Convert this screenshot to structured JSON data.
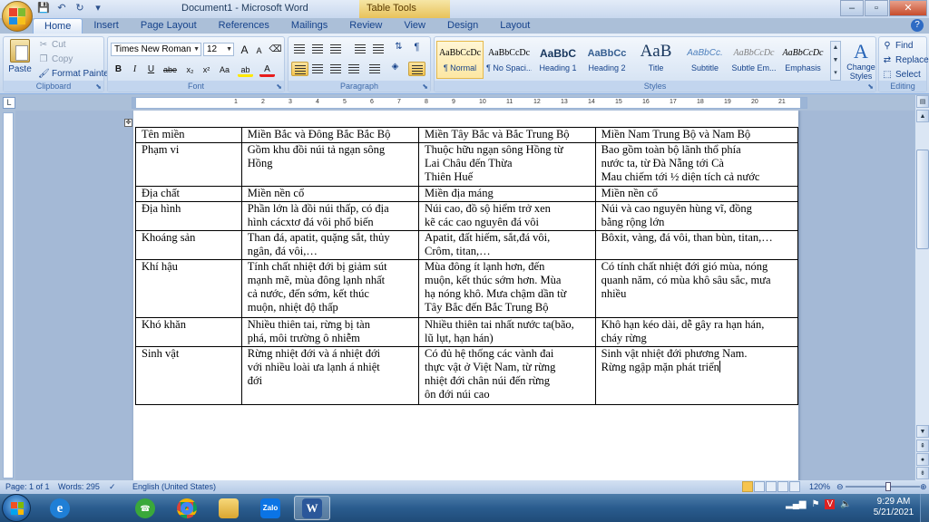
{
  "window": {
    "title": "Document1 - Microsoft Word",
    "context_tab": "Table Tools",
    "controls": [
      "–",
      "▫",
      "✕"
    ]
  },
  "qat": {
    "save": "💾",
    "undo": "↶",
    "redo": "↻",
    "more": "▾"
  },
  "tabs": [
    "Home",
    "Insert",
    "Page Layout",
    "References",
    "Mailings",
    "Review",
    "View",
    "Design",
    "Layout"
  ],
  "ribbon": {
    "clipboard": {
      "label": "Clipboard",
      "paste": "Paste",
      "cut": "Cut",
      "copy": "Copy",
      "format_painter": "Format Painter"
    },
    "font": {
      "label": "Font",
      "name": "Times New Roman",
      "size": "12",
      "grow": "A",
      "shrink": "A",
      "bold": "B",
      "italic": "I",
      "underline": "U",
      "strike": "abe",
      "sub": "x₂",
      "sup": "x²",
      "case": "Aa",
      "highlight": "ab",
      "color": "A"
    },
    "paragraph": {
      "label": "Paragraph"
    },
    "styles": {
      "label": "Styles",
      "items": [
        {
          "sample": "AaBbCcDc",
          "name": "¶ Normal"
        },
        {
          "sample": "AaBbCcDc",
          "name": "¶ No Spaci..."
        },
        {
          "sample": "AaBbC",
          "name": "Heading 1"
        },
        {
          "sample": "AaBbCc",
          "name": "Heading 2"
        },
        {
          "sample": "AaB",
          "name": "Title"
        },
        {
          "sample": "AaBbCc.",
          "name": "Subtitle"
        },
        {
          "sample": "AaBbCcDc",
          "name": "Subtle Em..."
        },
        {
          "sample": "AaBbCcDc",
          "name": "Emphasis"
        }
      ],
      "change_styles": "Change Styles"
    },
    "editing": {
      "label": "Editing",
      "find": "Find",
      "replace": "Replace",
      "select": "Select"
    }
  },
  "ruler": {
    "h_marks": [
      "1",
      "2",
      "3",
      "4",
      "5",
      "6",
      "7",
      "8",
      "9",
      "10",
      "11",
      "12",
      "13",
      "14",
      "15",
      "16",
      "17",
      "18",
      "19",
      "20",
      "21"
    ]
  },
  "table": {
    "rows": [
      [
        "Tên miền",
        "Miền Bắc và Đông Bắc Bắc Bộ",
        "Miền Tây Bắc và Bắc Trung Bộ",
        "Miền Nam Trung Bộ và Nam Bộ"
      ],
      [
        "Phạm vi",
        "Gồm khu đồi núi tả ngạn sông|Hồng",
        "Thuộc hữu ngạn sông Hồng từ|Lai Châu đến Thừa|Thiên Huế",
        "Bao gồm toàn bộ lãnh thổ phía|nước ta, từ Đà Nẵng tới Cà|Mau chiếm tới ½ diện tích cả nước"
      ],
      [
        "Địa chất",
        "Miền nền cổ",
        "Miền địa máng",
        "Miền nền cổ"
      ],
      [
        "Địa hình",
        "Phần lớn là đồi núi thấp, có địa|hình cácxtơ đá vôi phổ biến",
        "Núi cao, đồ sộ hiểm trở xen|kẽ các cao nguyên đá vôi",
        "Núi và cao nguyên hùng vĩ, đồng|bằng rộng lớn"
      ],
      [
        "Khoáng sản",
        "Than đá, apatit, quặng sắt, thủy|ngân, đá vôi,…",
        "Apatit, đất hiếm, sắt,đá vôi,|Crôm, titan,…",
        "Bôxit, vàng, đá vôi, than bùn, titan,…"
      ],
      [
        "Khí hậu",
        "Tính chất nhiệt đới bị giảm sút|mạnh mẽ, mùa đông lạnh nhất|cả nước, đến sớm, kết thúc|muộn, nhiệt độ thấp",
        "Mùa đông ít lạnh hơn, đến|muộn, kết thúc sớm hơn. Mùa|hạ nóng khô. Mưa chậm dần từ|Tây Bắc đến Bắc Trung Bộ",
        "Có tính chất nhiệt đới gió mùa, nóng|quanh năm, có mùa khô sâu sắc, mưa|nhiều"
      ],
      [
        "Khó khăn",
        "Nhiều thiên tai, rừng bị tàn|phá, môi trường ô nhiễm",
        "Nhiều thiên tai nhất nước ta(bão,|lũ lụt, hạn hán)",
        "Khô hạn kéo dài, dễ gây ra hạn  hán,|cháy rừng"
      ],
      [
        "Sinh vật",
        "Rừng nhiệt đới và á nhiệt đới|với nhiều loài ưa lạnh á nhiệt|đới",
        "Có đủ hệ thống các vành đai|thực vật ở Việt Nam, từ rừng|nhiệt đới chân núi đến rừng|ôn đới núi cao",
        "Sinh vật nhiệt đới phương Nam.|Rừng ngập mặn phát triển"
      ]
    ]
  },
  "status": {
    "page": "Page: 1 of 1",
    "words": "Words: 295",
    "language": "English (United States)",
    "zoom": "120%"
  },
  "taskbar": {
    "time": "9:29 AM",
    "date": "5/21/2021",
    "apps": [
      "IE",
      "Zalo-Green",
      "Chrome",
      "Explorer",
      "Zalo",
      "Word"
    ]
  },
  "colors": {
    "ribbon": "#c5d6ec",
    "accent": "#15428b",
    "active_style": "#fde7a3"
  }
}
